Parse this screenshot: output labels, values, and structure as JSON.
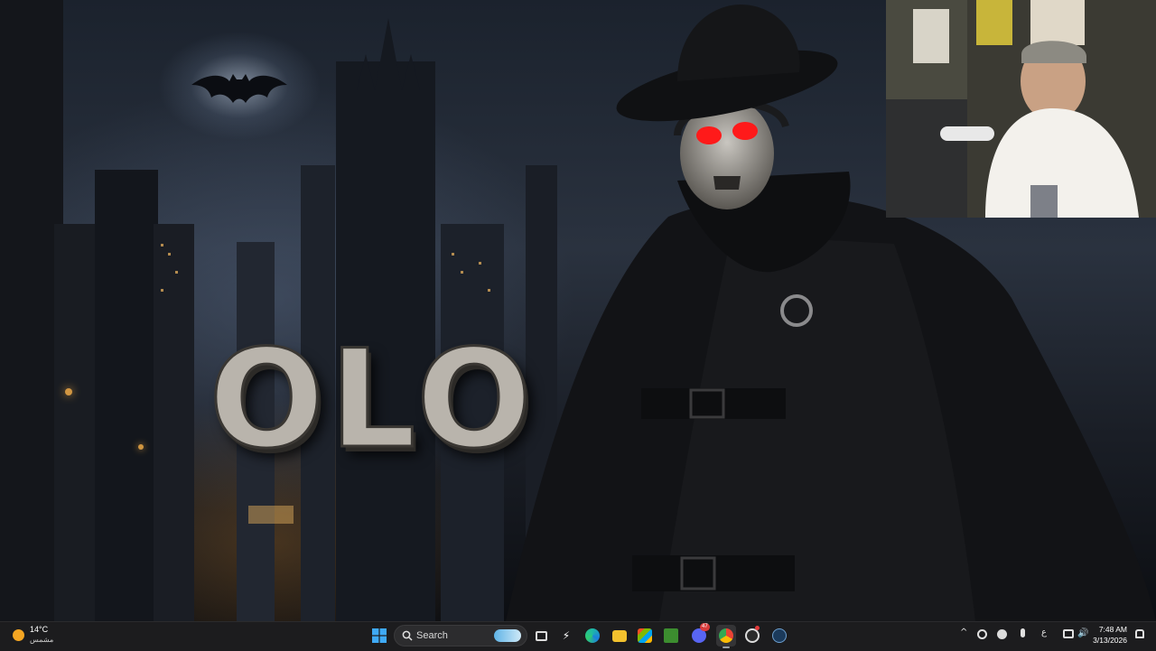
{
  "wallpaper": {
    "logo_text": "OLO"
  },
  "taskbar": {
    "weather": {
      "temperature": "14°C",
      "condition": "مشمس",
      "icon": "sun-icon"
    },
    "start_icon": "windows-logo-icon",
    "search": {
      "label": "Search",
      "icon": "search-icon"
    },
    "pinned": [
      {
        "name": "task-view-icon"
      },
      {
        "name": "copilot-icon"
      },
      {
        "name": "edge-icon"
      },
      {
        "name": "file-explorer-icon"
      },
      {
        "name": "microsoft-store-icon"
      },
      {
        "name": "minecraft-icon"
      },
      {
        "name": "discord-icon",
        "badge": "47"
      },
      {
        "name": "chrome-icon"
      },
      {
        "name": "obs-icon"
      },
      {
        "name": "steam-icon"
      }
    ],
    "tray": {
      "chevron": "^",
      "language": "ع",
      "clock_time": "7:48 AM",
      "clock_date": "3/13/2026"
    }
  },
  "colors": {
    "taskbar_bg": "#1c1c1e",
    "accent": "#0078d4"
  }
}
